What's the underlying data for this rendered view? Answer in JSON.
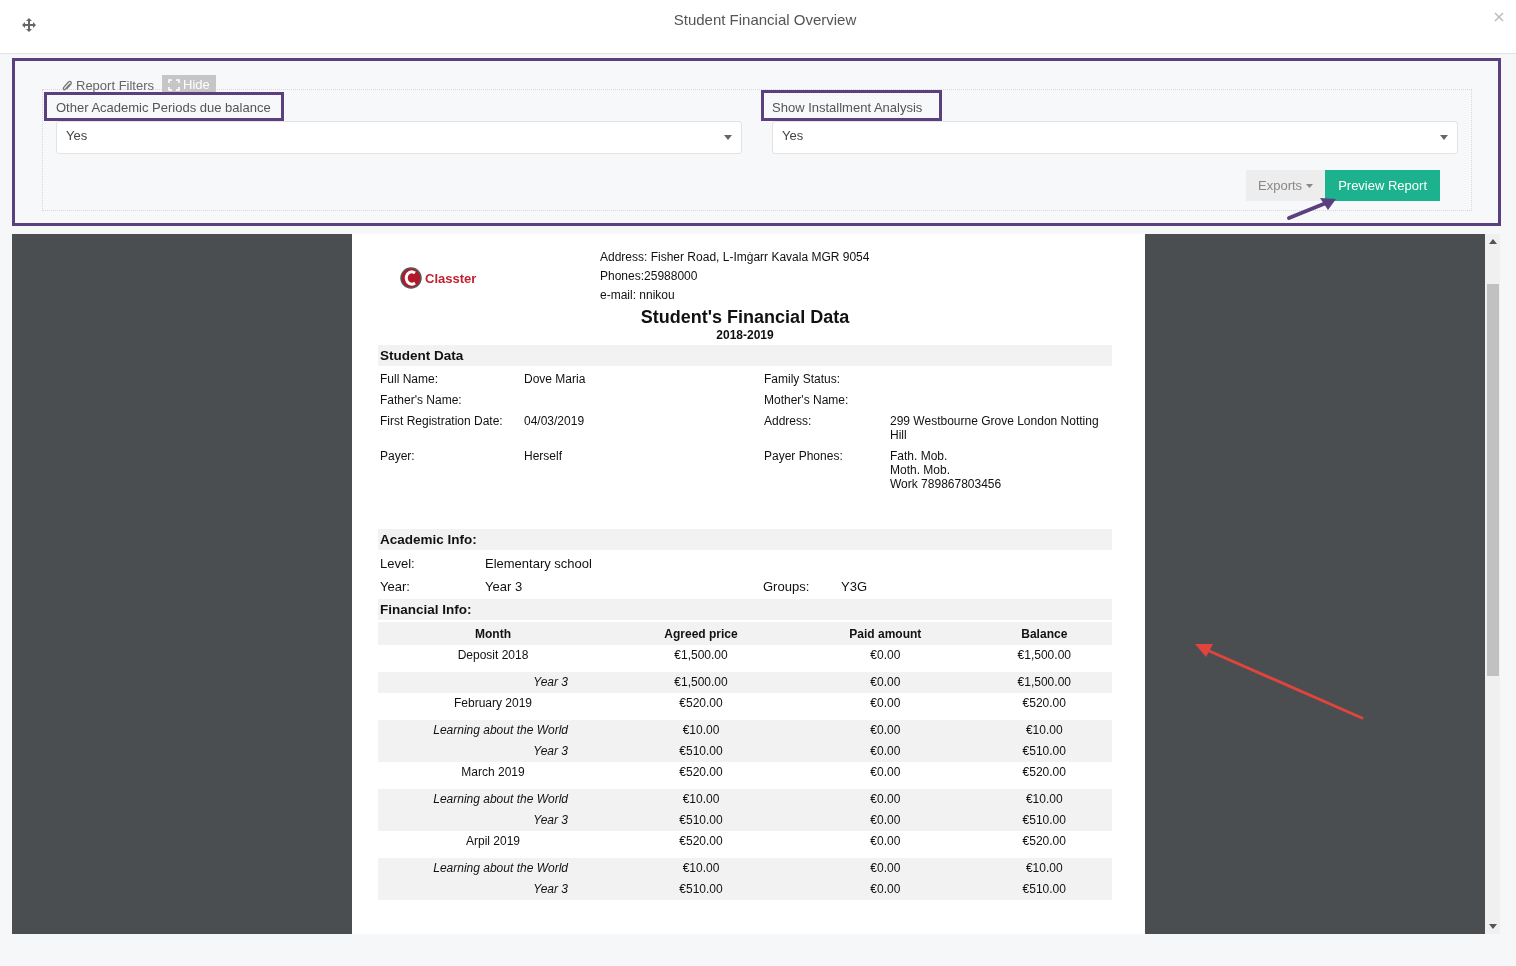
{
  "dialog": {
    "title": "Student Financial Overview"
  },
  "filters": {
    "tab_label": "Report Filters",
    "hide_button": "Hide",
    "fields": [
      {
        "label": "Other Academic Periods due balance",
        "value": "Yes"
      },
      {
        "label": "Show Installment Analysis",
        "value": "Yes"
      }
    ],
    "exports_button": "Exports",
    "preview_button": "Preview Report"
  },
  "report": {
    "logo_text": "Classter",
    "contact_lines": [
      "Address: Fisher Road, L-Imġarr  Kavala MGR 9054",
      "Phones:25988000",
      "e-mail: nnikou"
    ],
    "title": "Student's Financial Data",
    "period": "2018-2019",
    "student_data": {
      "heading": "Student Data",
      "rows": [
        {
          "left": {
            "label": "Full Name:",
            "value": [
              "Dove Maria"
            ]
          },
          "right": {
            "label": "Family Status:"
          }
        },
        {
          "left": {
            "label": "Father's Name:"
          },
          "right": {
            "label": "Mother's Name:"
          }
        },
        {
          "left": {
            "label": "First Registration Date:",
            "value": [
              "04/03/2019"
            ]
          },
          "right": {
            "label": "Address:",
            "value": [
              "299 Westbourne Grove London Notting Hill"
            ]
          }
        },
        {
          "left": {
            "label": "Payer:",
            "value": [
              "Herself"
            ]
          },
          "right": {
            "label": "Payer Phones:",
            "value": [
              "Fath. Mob.",
              "Moth. Mob.",
              "Work 789867803456"
            ]
          }
        }
      ]
    },
    "academic_info": {
      "heading": "Academic Info:",
      "rows": [
        {
          "left": {
            "label": "Level:",
            "value": "Elementary school"
          }
        },
        {
          "left": {
            "label": "Year:",
            "value": "Year 3"
          },
          "right": {
            "label": "Groups:",
            "value": "Y3G"
          }
        }
      ]
    },
    "financial_info": {
      "heading": "Financial Info:",
      "columns": [
        "Month",
        "Agreed price",
        "Paid amount",
        "Balance"
      ],
      "rows": [
        {
          "kind": "month",
          "cells": [
            "Deposit 2018",
            "€1,500.00",
            "€0.00",
            "€1,500.00"
          ]
        },
        {
          "kind": "item",
          "cells": [
            "Year 3",
            "€1,500.00",
            "€0.00",
            "€1,500.00"
          ]
        },
        {
          "kind": "month",
          "cells": [
            "February 2019",
            "€520.00",
            "€0.00",
            "€520.00"
          ]
        },
        {
          "kind": "item",
          "cells": [
            "Learning about the World",
            "€10.00",
            "€0.00",
            "€10.00"
          ]
        },
        {
          "kind": "item",
          "cells": [
            "Year 3",
            "€510.00",
            "€0.00",
            "€510.00"
          ]
        },
        {
          "kind": "month",
          "cells": [
            "March 2019",
            "€520.00",
            "€0.00",
            "€520.00"
          ]
        },
        {
          "kind": "item",
          "cells": [
            "Learning about the World",
            "€10.00",
            "€0.00",
            "€10.00"
          ]
        },
        {
          "kind": "item",
          "cells": [
            "Year 3",
            "€510.00",
            "€0.00",
            "€510.00"
          ]
        },
        {
          "kind": "month",
          "cells": [
            "Arpil 2019",
            "€520.00",
            "€0.00",
            "€520.00"
          ]
        },
        {
          "kind": "item",
          "cells": [
            "Learning about the World",
            "€10.00",
            "€0.00",
            "€10.00"
          ]
        },
        {
          "kind": "item",
          "cells": [
            "Year 3",
            "€510.00",
            "€0.00",
            "€510.00"
          ]
        }
      ]
    }
  }
}
